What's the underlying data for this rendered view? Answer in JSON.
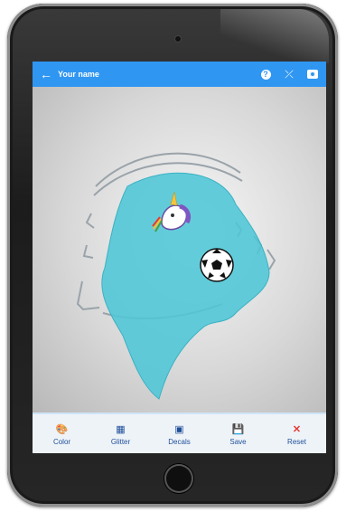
{
  "header": {
    "title": "Your name",
    "back_icon": "arrow-left-icon",
    "help_icon": "help-circle-icon",
    "expand_icon": "expand-arrows-icon",
    "camera_icon": "camera-icon",
    "help_glyph": "?",
    "expand_glyph": "⤫"
  },
  "viewer": {
    "acrylic_color": "#4fc6d6",
    "decals": [
      "unicorn-icon",
      "soccer-ball-icon"
    ]
  },
  "toolbar": {
    "items": [
      {
        "label": "Color",
        "icon": "palette-icon",
        "glyph": "🎨"
      },
      {
        "label": "Glitter",
        "icon": "glitter-icon",
        "glyph": "▦"
      },
      {
        "label": "Decals",
        "icon": "image-icon",
        "glyph": "▣"
      },
      {
        "label": "Save",
        "icon": "save-icon",
        "glyph": "💾"
      },
      {
        "label": "Reset",
        "icon": "close-icon",
        "glyph": "✕"
      }
    ]
  },
  "colors": {
    "appbar": "#2f96f2",
    "toolbar_text": "#1f4f9a",
    "reset": "#e53935"
  }
}
